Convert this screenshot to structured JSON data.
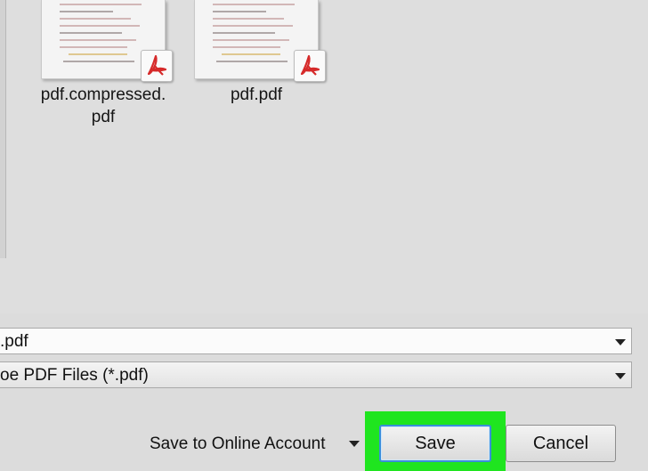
{
  "files": [
    {
      "name_line1": "pdf.compressed.",
      "name_line2": "pdf",
      "icon": "pdf-file-icon"
    },
    {
      "name_line1": "pdf.pdf",
      "name_line2": "",
      "icon": "pdf-file-icon"
    }
  ],
  "file_name_field": {
    "value": ".pdf"
  },
  "file_type_field": {
    "value": "oe PDF Files (*.pdf)"
  },
  "footer": {
    "online_account_label": "Save to Online Account",
    "save_label": "Save",
    "cancel_label": "Cancel"
  },
  "colors": {
    "highlight": "#1fe51f",
    "save_border": "#3a8fd9",
    "acrobat_red": "#d62a2a"
  }
}
